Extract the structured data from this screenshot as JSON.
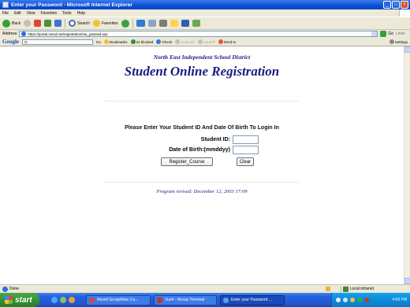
{
  "window": {
    "title": "Enter your Password - Microsoft Internet Explorer",
    "controls": {
      "minimize": "_",
      "maximize": "□",
      "close": "×"
    }
  },
  "menu": [
    "File",
    "Edit",
    "View",
    "Favorites",
    "Tools",
    "Help"
  ],
  "toolbar": {
    "back": "Back",
    "search": "Search",
    "favorites": "Favorites"
  },
  "address": {
    "label": "Address",
    "url": "https://portal.neisd.net/registration/stu_passwd.asp",
    "go": "Go",
    "links": "Links"
  },
  "google_bar": {
    "logo": "Google",
    "search_prefix": "G-",
    "go": "Go",
    "bookmarks": "Bookmarks",
    "blocked": "24 blocked",
    "check": "Check",
    "autolink": "AutoLink",
    "autofill": "AutoFill",
    "send_to": "Send to",
    "settings": "Settings"
  },
  "page": {
    "district": "North East Independent School District",
    "title": "Student Online Registration",
    "prompt": "Please Enter Your Student ID And Date Of Birth To Login In",
    "student_id_label": "Student ID:",
    "dob_label": "Date of Birth:(mmddyy)",
    "register_button": "Register_Course",
    "clear_button": "Clear",
    "revised": "Program revised: December 12, 2003 17:09"
  },
  "status": {
    "text": "Done",
    "zone": "Local intranet"
  },
  "taskbar": {
    "start": "start",
    "tasks": [
      {
        "label": "Novell GroupWise Ca...",
        "active": false
      },
      {
        "label": "Vue4 - Nexus Terminal",
        "active": false
      },
      {
        "label": "Enter your Password ...",
        "active": true
      }
    ],
    "clock": "4:09 PM"
  }
}
